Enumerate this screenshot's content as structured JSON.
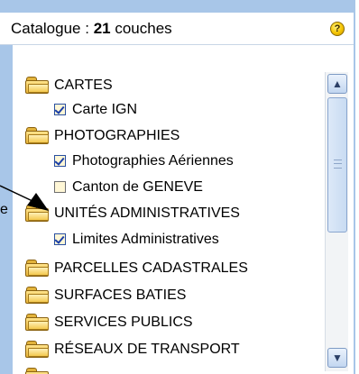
{
  "catalogue": {
    "title_prefix": "Catalogue : ",
    "count": "21",
    "title_suffix": " couches",
    "help_glyph": "?"
  },
  "tree": {
    "groups": [
      {
        "label": "CARTES",
        "items": [
          {
            "label": "Carte IGN",
            "checked": true
          }
        ]
      },
      {
        "label": "PHOTOGRAPHIES",
        "items": [
          {
            "label": "Photographies Aériennes",
            "checked": true
          },
          {
            "label": "Canton de GENEVE",
            "checked": false
          }
        ]
      },
      {
        "label": "UNITÉS ADMINISTRATIVES",
        "items": [
          {
            "label": "Limites Administratives",
            "checked": true
          }
        ]
      },
      {
        "label": "PARCELLES CADASTRALES",
        "items": []
      },
      {
        "label": "SURFACES BATIES",
        "items": []
      },
      {
        "label": "SERVICES PUBLICS",
        "items": []
      },
      {
        "label": "RÉSEAUX DE TRANSPORT",
        "items": []
      }
    ]
  },
  "scrollbar": {
    "up_glyph": "▲",
    "down_glyph": "▼"
  },
  "annotation": {
    "text": "e"
  },
  "colors": {
    "panel_frame": "#a8c6e8",
    "folder": "#e8b43a",
    "check": "#1a3fa8"
  }
}
